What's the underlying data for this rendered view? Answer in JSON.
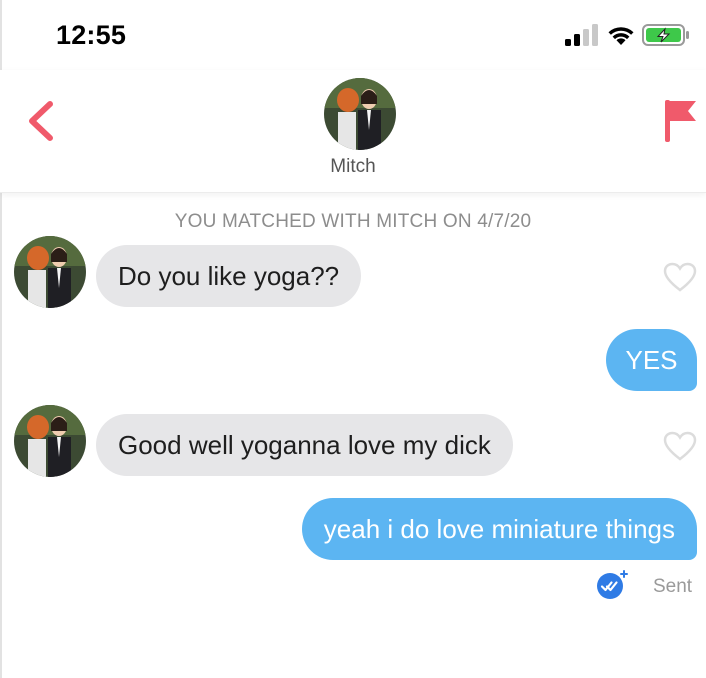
{
  "status_bar": {
    "time": "12:55",
    "icons": [
      "cellular-signal-icon",
      "wifi-icon",
      "battery-charging-icon"
    ]
  },
  "header": {
    "name": "Mitch",
    "back_icon": "chevron-left-icon",
    "report_icon": "flag-icon",
    "avatar": "match-avatar"
  },
  "chat": {
    "match_banner": "YOU MATCHED WITH MITCH ON 4/7/20",
    "messages": [
      {
        "from": "them",
        "text": "Do you like yoga??"
      },
      {
        "from": "me",
        "text": "YES"
      },
      {
        "from": "them",
        "text": "Good well yoganna love my dick"
      },
      {
        "from": "me",
        "text": "yeah i do love miniature things"
      }
    ],
    "receipt_icon": "double-check-icon",
    "status": "Sent"
  },
  "colors": {
    "accent": "#f05a6b",
    "outgoing_bubble": "#5cb5f2",
    "incoming_bubble": "#e6e6e8",
    "receipt": "#2f7be5",
    "battery": "#3ec84a"
  }
}
